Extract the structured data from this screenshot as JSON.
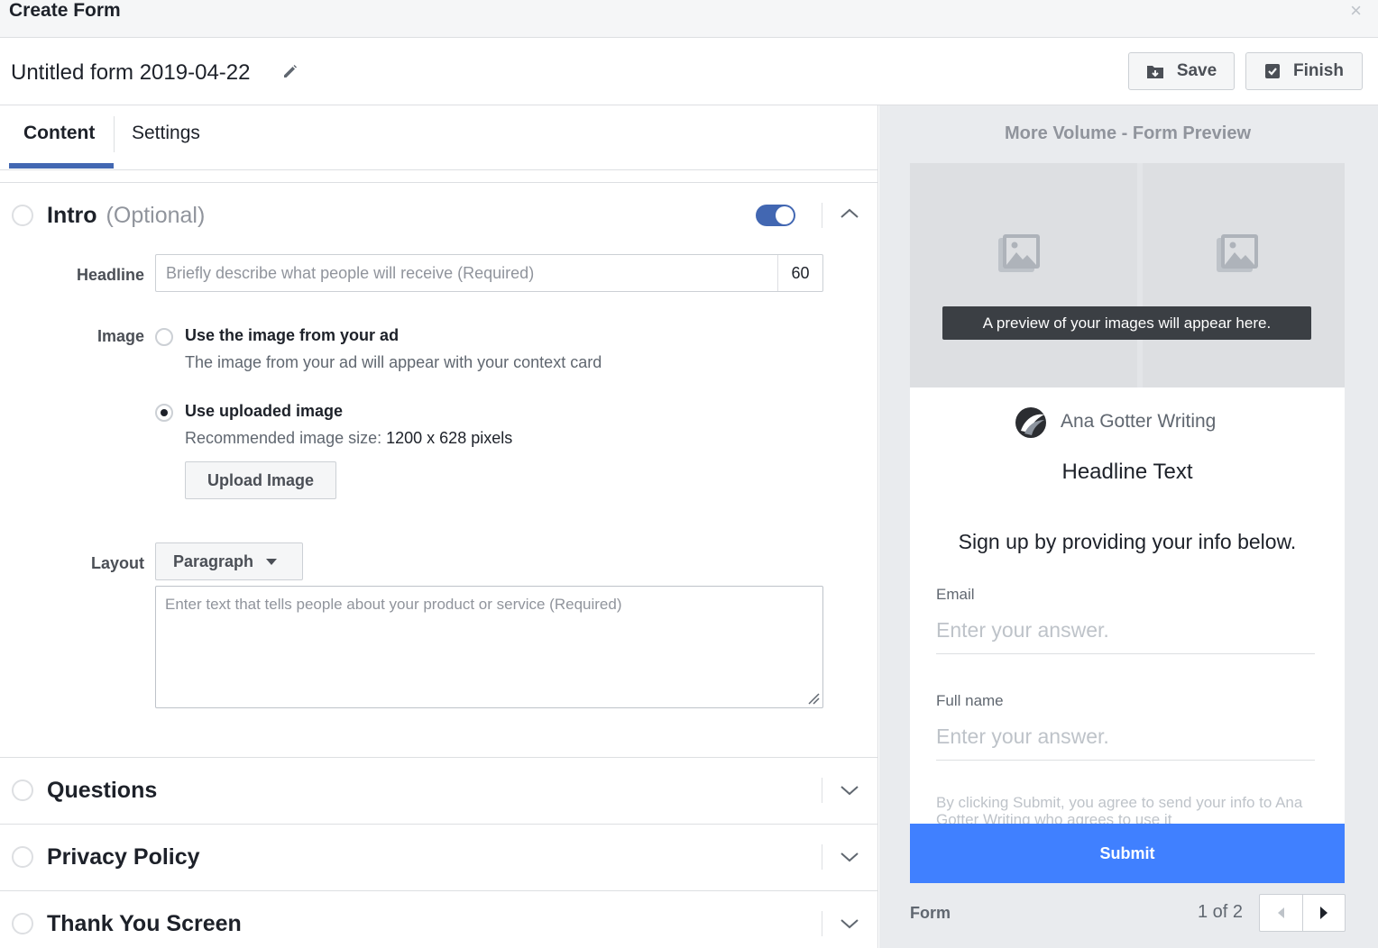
{
  "window": {
    "title": "Create Form",
    "close_icon": "×"
  },
  "form_header": {
    "name": "Untitled form 2019-04-22",
    "save_label": "Save",
    "finish_label": "Finish"
  },
  "tabs": [
    {
      "label": "Content",
      "active": true
    },
    {
      "label": "Settings",
      "active": false
    }
  ],
  "intro": {
    "title": "Intro",
    "optional": "(Optional)",
    "enabled": true,
    "headline_label": "Headline",
    "headline_placeholder": "Briefly describe what people will receive (Required)",
    "headline_remaining": "60",
    "image_label": "Image",
    "image_options": [
      {
        "title": "Use the image from your ad",
        "desc": "The image from your ad will appear with your context card",
        "selected": false
      },
      {
        "title": "Use uploaded image",
        "desc_prefix": "Recommended image size:",
        "desc_value": "1200 x 628 pixels",
        "selected": true
      }
    ],
    "upload_label": "Upload Image",
    "layout_label": "Layout",
    "layout_value": "Paragraph",
    "text_placeholder": "Enter text that tells people about your product or service (Required)"
  },
  "sections": [
    {
      "title": "Questions"
    },
    {
      "title": "Privacy Policy"
    },
    {
      "title": "Thank You Screen"
    }
  ],
  "preview": {
    "title": "More Volume - Form Preview",
    "image_tooltip": "A preview of your images will appear here.",
    "page_name": "Ana Gotter Writing",
    "headline": "Headline Text",
    "description": "Sign up by providing your info below.",
    "fields": [
      {
        "label": "Email",
        "placeholder": "Enter your answer."
      },
      {
        "label": "Full name",
        "placeholder": "Enter your answer."
      }
    ],
    "disclaimer": "By clicking Submit, you agree to send your info to Ana Gotter Writing who agrees to use it",
    "submit_label": "Submit",
    "footer_label": "Form",
    "page_indicator": "1 of 2"
  },
  "colors": {
    "accent": "#4267b2",
    "submit": "#4080ff",
    "panel_bg": "#e9ebee"
  },
  "icons": [
    "close-icon",
    "pencil-icon",
    "save-icon",
    "finish-icon",
    "chevron-up-icon",
    "chevron-down-icon",
    "image-placeholder-icon",
    "page-logo",
    "resize-grip-icon",
    "arrow-left-icon",
    "arrow-right-icon"
  ]
}
